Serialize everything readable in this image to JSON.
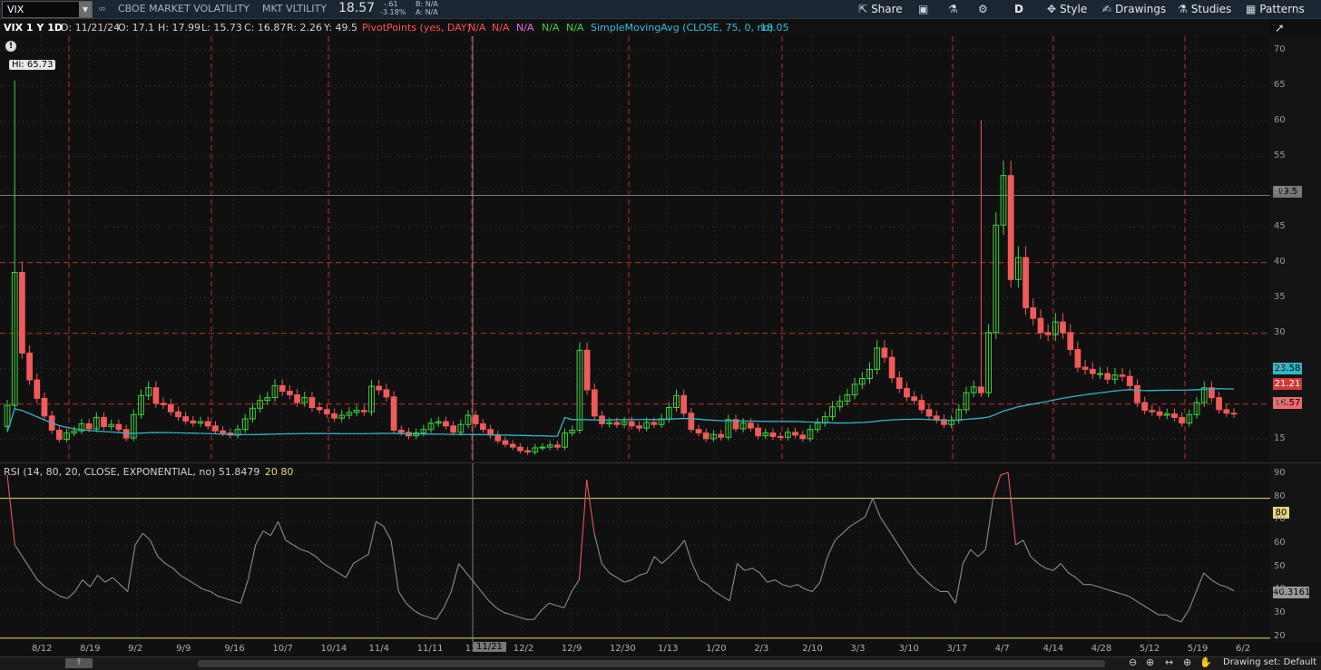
{
  "header": {
    "symbol": "VIX",
    "description": "CBOE MARKET VOLATILITY",
    "exchange": "MKT VLTILITY",
    "last": "18.57",
    "change": "-.61",
    "change_pct": "-3.18%",
    "bid": "B: N/A",
    "ask": "A: N/A",
    "share_label": "Share",
    "aggregation_label": "D",
    "style_label": "Style",
    "drawings_label": "Drawings",
    "studies_label": "Studies",
    "patterns_label": "Patterns"
  },
  "info": {
    "period": "VIX 1 Y 1D",
    "date": "D: 11/21/24",
    "open": "O: 17.1",
    "high": "H: 17.99",
    "low": "L: 15.73",
    "close": "C: 16.87",
    "range": "R: 2.26",
    "y": "Y: 49.5",
    "pivot_study": "PivotPoints (yes, DAY)",
    "pivot_values": [
      "N/A",
      "N/A",
      "N/A",
      "N/A",
      "N/A"
    ],
    "sma_study": "SimpleMovingAvg (CLOSE, 75, 0, no)",
    "sma_value": "18.05",
    "hi_label": "Hi: 65.73"
  },
  "rsi_info": {
    "study": "RSI (14, 80, 20, CLOSE, EXPONENTIAL, no)",
    "value": "51.8479",
    "lower": "20",
    "upper": "80",
    "current_tag": "40.3161",
    "upper_tag": "80"
  },
  "price_tags": {
    "crosshair": "49.5",
    "sma": "23.58",
    "pivot": "21.21",
    "last": "18.57"
  },
  "footer": {
    "drawing_set": "Drawing set: Default",
    "crosshair_date": "11/21"
  },
  "colors": {
    "up": "#3fd33f",
    "down": "#f05a5a",
    "sma": "#2bb7c9",
    "rsi": "#8c8c8c",
    "rsi_hot": "#e25858",
    "rsi_bands": "#e8d67a",
    "pivot_line": "#c22a2a",
    "accent_bar": "#1b2632"
  },
  "chart_data": [
    {
      "type": "candlestick",
      "title": "VIX 1 Y 1D",
      "ylim": [
        12,
        72
      ],
      "y_ticks": [
        15,
        20,
        25,
        30,
        35,
        40,
        45,
        50,
        55,
        60,
        65,
        70
      ],
      "x_tick_labels": [
        "8/12",
        "8/19",
        "9/2",
        "9/9",
        "9/16",
        "10/7",
        "10/14",
        "11/4",
        "11/11",
        "11/21",
        "12/2",
        "12/9",
        "12/30",
        "1/13",
        "1/20",
        "2/3",
        "2/10",
        "3/3",
        "3/10",
        "3/17",
        "4/7",
        "4/14",
        "4/28",
        "5/12",
        "5/19",
        "6/2"
      ],
      "closes": [
        19.8,
        38.6,
        27.2,
        23.4,
        20.8,
        18.3,
        16.3,
        15.0,
        15.9,
        16.2,
        17.2,
        16.5,
        18.1,
        16.8,
        17.1,
        16.4,
        15.2,
        18.5,
        21.2,
        22.3,
        20.1,
        19.9,
        18.9,
        18.2,
        17.6,
        17.3,
        17.5,
        16.9,
        16.2,
        15.9,
        15.6,
        16.4,
        17.9,
        19.4,
        20.5,
        20.9,
        22.6,
        21.8,
        21.3,
        20.2,
        20.9,
        19.5,
        19.2,
        18.6,
        18.0,
        18.4,
        18.8,
        19.1,
        18.9,
        22.5,
        22.0,
        21.0,
        16.3,
        16.0,
        15.5,
        15.9,
        16.4,
        17.3,
        17.5,
        16.9,
        16.0,
        17.1,
        18.4,
        17.2,
        16.4,
        15.6,
        14.8,
        14.3,
        13.9,
        13.4,
        13.2,
        13.8,
        13.9,
        14.2,
        13.9,
        15.9,
        16.3,
        27.6,
        22.0,
        18.3,
        17.2,
        17.4,
        17.1,
        17.5,
        16.9,
        16.6,
        17.4,
        17.1,
        17.9,
        19.5,
        21.2,
        18.7,
        16.4,
        15.9,
        15.1,
        15.7,
        15.3,
        17.8,
        16.5,
        17.3,
        16.6,
        15.5,
        15.9,
        15.4,
        15.3,
        16.0,
        15.6,
        15.1,
        16.4,
        17.3,
        18.2,
        19.6,
        20.4,
        21.3,
        22.8,
        23.6,
        24.9,
        27.9,
        26.6,
        23.7,
        22.2,
        21.0,
        20.5,
        19.2,
        18.3,
        17.8,
        17.1,
        17.7,
        19.2,
        21.6,
        22.4,
        21.6,
        30.1,
        45.3,
        52.3,
        37.6,
        40.7,
        33.6,
        32.1,
        30.1,
        29.8,
        31.6,
        30.1,
        27.7,
        25.2,
        24.9,
        24.3,
        24.3,
        23.5,
        24.1,
        23.9,
        22.6,
        20.2,
        19.1,
        18.9,
        18.4,
        18.6,
        18.1,
        17.3,
        18.5,
        20.2,
        22.3,
        20.9,
        19.2,
        18.7,
        18.57
      ],
      "sma_last": 23.58,
      "crosshair_y": 49.5,
      "pivot_levels": [
        20,
        30,
        40
      ],
      "hi": 65.73
    },
    {
      "type": "line",
      "title": "RSI (14, 80, 20, CLOSE, EXPONENTIAL, no)",
      "ylim": [
        18,
        95
      ],
      "y_ticks": [
        20,
        30,
        40,
        50,
        60,
        70,
        80,
        90
      ],
      "bands": [
        20,
        80
      ],
      "values": [
        90,
        60,
        55,
        50,
        45,
        42,
        40,
        38,
        37,
        40,
        45,
        42,
        47,
        44,
        46,
        43,
        40,
        60,
        65,
        62,
        55,
        52,
        50,
        47,
        45,
        43,
        41,
        40,
        38,
        37,
        36,
        35,
        45,
        60,
        66,
        64,
        70,
        62,
        60,
        58,
        57,
        55,
        52,
        50,
        48,
        46,
        52,
        54,
        56,
        70,
        68,
        62,
        40,
        35,
        32,
        30,
        29,
        28,
        33,
        40,
        52,
        48,
        44,
        40,
        36,
        33,
        31,
        30,
        29,
        28,
        28,
        32,
        35,
        34,
        33,
        40,
        45,
        88,
        65,
        52,
        48,
        46,
        44,
        45,
        47,
        48,
        55,
        52,
        55,
        58,
        62,
        52,
        45,
        43,
        40,
        38,
        36,
        52,
        49,
        50,
        48,
        44,
        45,
        43,
        42,
        43,
        41,
        40,
        44,
        55,
        62,
        65,
        68,
        70,
        72,
        80,
        72,
        67,
        62,
        57,
        52,
        48,
        45,
        42,
        40,
        40,
        35,
        52,
        58,
        55,
        58,
        80,
        90,
        91,
        60,
        62,
        55,
        52,
        50,
        49,
        52,
        48,
        46,
        43,
        43,
        42,
        41,
        40,
        39,
        38,
        36,
        34,
        32,
        30,
        30,
        28,
        27,
        32,
        40,
        48,
        45,
        43,
        42,
        40.3161
      ]
    }
  ]
}
